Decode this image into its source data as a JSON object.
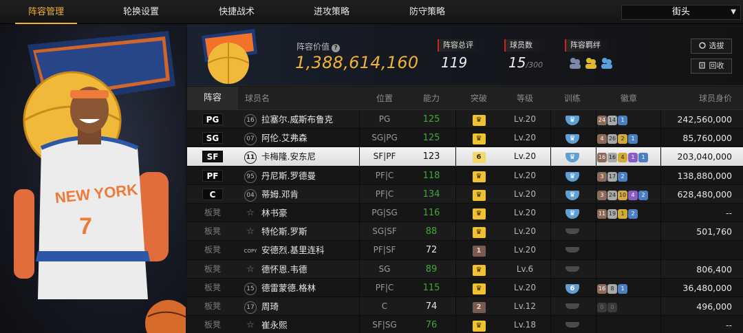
{
  "nav": {
    "tabs": [
      "阵容管理",
      "轮换设置",
      "快捷战术",
      "进攻策略",
      "防守策略"
    ],
    "active": 0,
    "dropdown": "街头"
  },
  "header": {
    "value_label": "阵容价值",
    "value": "1,388,614,160",
    "rating_label": "阵容总评",
    "rating": "119",
    "players_label": "球员数",
    "players": "15",
    "players_max": "/300",
    "synergy_label": "阵容羁绊",
    "btn_scout": "选拔",
    "btn_back": "回收"
  },
  "columns": {
    "role": "阵容",
    "name": "球员名",
    "pos": "位置",
    "ovr": "能力",
    "brk": "突破",
    "lvl": "等级",
    "trn": "训练",
    "badge": "徽章",
    "sal": "球员身价"
  },
  "rows": [
    {
      "role": "PG",
      "num": "16",
      "name": "拉塞尔.威斯布鲁克",
      "pos": "PG",
      "ovr": "125",
      "ovr_color": "green",
      "brk": "",
      "brk_style": "gold",
      "lvl": "Lv.20",
      "trn": "",
      "trn_style": "blue",
      "badges": [
        [
          "24",
          "b"
        ],
        [
          "14",
          "s"
        ],
        [
          "1",
          "u"
        ]
      ],
      "sal": "242,560,000"
    },
    {
      "role": "SG",
      "num": "07",
      "name": "阿伦.艾弗森",
      "pos": "SG|PG",
      "ovr": "125",
      "ovr_color": "green",
      "brk": "",
      "brk_style": "gold",
      "lvl": "Lv.20",
      "trn": "",
      "trn_style": "blue",
      "badges": [
        [
          "4",
          "b"
        ],
        [
          "26",
          "s"
        ],
        [
          "2",
          "g"
        ],
        [
          "1",
          "u"
        ]
      ],
      "sal": "85,760,000"
    },
    {
      "role": "SF",
      "num": "11",
      "name": "卡梅隆.安东尼",
      "pos": "SF|PF",
      "ovr": "123",
      "ovr_color": "white",
      "brk": "6",
      "brk_style": "lg",
      "lvl": "Lv.20",
      "trn": "",
      "trn_style": "blue",
      "badges": [
        [
          "16",
          "b"
        ],
        [
          "16",
          "s"
        ],
        [
          "4",
          "g"
        ],
        [
          "1",
          "p"
        ],
        [
          "1",
          "u"
        ]
      ],
      "sal": "203,040,000",
      "selected": true
    },
    {
      "role": "PF",
      "num": "95",
      "name": "丹尼斯.罗德曼",
      "pos": "PF|C",
      "ovr": "118",
      "ovr_color": "green",
      "brk": "",
      "brk_style": "gold",
      "lvl": "Lv.20",
      "trn": "",
      "trn_style": "blue",
      "badges": [
        [
          "3",
          "b"
        ],
        [
          "17",
          "s"
        ],
        [
          "2",
          "u"
        ]
      ],
      "sal": "138,880,000"
    },
    {
      "role": "C",
      "num": "04",
      "name": "蒂姆.邓肯",
      "pos": "PF|C",
      "ovr": "134",
      "ovr_color": "green",
      "brk": "",
      "brk_style": "gold",
      "lvl": "Lv.20",
      "trn": "",
      "trn_style": "blue",
      "badges": [
        [
          "3",
          "b"
        ],
        [
          "24",
          "s"
        ],
        [
          "10",
          "g"
        ],
        [
          "4",
          "p"
        ],
        [
          "2",
          "u"
        ]
      ],
      "sal": "628,480,000"
    },
    {
      "role": "板凳",
      "num": "",
      "name": "林书豪",
      "pos": "PG|SG",
      "ovr": "116",
      "ovr_color": "green",
      "brk": "",
      "brk_style": "gold",
      "lvl": "Lv.20",
      "trn": "",
      "trn_style": "blue",
      "badges": [
        [
          "11",
          "b"
        ],
        [
          "19",
          "s"
        ],
        [
          "1",
          "g"
        ],
        [
          "2",
          "u"
        ]
      ],
      "sal": "--"
    },
    {
      "role": "板凳",
      "num": "",
      "name": "特伦斯.罗斯",
      "pos": "SG|SF",
      "ovr": "88",
      "ovr_color": "green",
      "brk": "",
      "brk_style": "gold",
      "lvl": "Lv.20",
      "trn": "",
      "trn_style": "grey",
      "badges": [],
      "sal": "501,760"
    },
    {
      "role": "板凳",
      "num": "COPY",
      "name": "安德烈.基里连科",
      "pos": "PF|SF",
      "ovr": "72",
      "ovr_color": "white",
      "brk": "1",
      "brk_style": "br",
      "lvl": "Lv.20",
      "trn": "",
      "trn_style": "grey",
      "badges": [],
      "sal": ""
    },
    {
      "role": "板凳",
      "num": "",
      "name": "德怀恩.韦德",
      "pos": "SG",
      "ovr": "89",
      "ovr_color": "green",
      "brk": "",
      "brk_style": "gold",
      "lvl": "Lv.6",
      "trn": "",
      "trn_style": "grey",
      "badges": [],
      "sal": "806,400"
    },
    {
      "role": "板凳",
      "num": "15",
      "name": "德雷蒙德.格林",
      "pos": "PF|C",
      "ovr": "115",
      "ovr_color": "green",
      "brk": "",
      "brk_style": "gold",
      "lvl": "Lv.20",
      "trn": "6",
      "trn_style": "blue",
      "badges": [
        [
          "16",
          "b"
        ],
        [
          "8",
          "s"
        ],
        [
          "1",
          "u"
        ]
      ],
      "sal": "36,480,000"
    },
    {
      "role": "板凳",
      "num": "17",
      "name": "周琦",
      "pos": "C",
      "ovr": "74",
      "ovr_color": "white",
      "brk": "2",
      "brk_style": "br",
      "lvl": "Lv.12",
      "trn": "",
      "trn_style": "grey",
      "badges": [
        [
          "0",
          "d"
        ],
        [
          "0",
          "d"
        ]
      ],
      "sal": "496,000"
    },
    {
      "role": "板凳",
      "num": "",
      "name": "崔永熙",
      "pos": "SF|SG",
      "ovr": "76",
      "ovr_color": "green",
      "brk": "",
      "brk_style": "gold",
      "lvl": "Lv.18",
      "trn": "",
      "trn_style": "grey",
      "badges": [],
      "sal": "--"
    }
  ],
  "colors": {
    "accent": "#f2b233",
    "green": "#3fa83a",
    "training_blue": "#5f9fd3",
    "mark_red": "#d02020"
  }
}
